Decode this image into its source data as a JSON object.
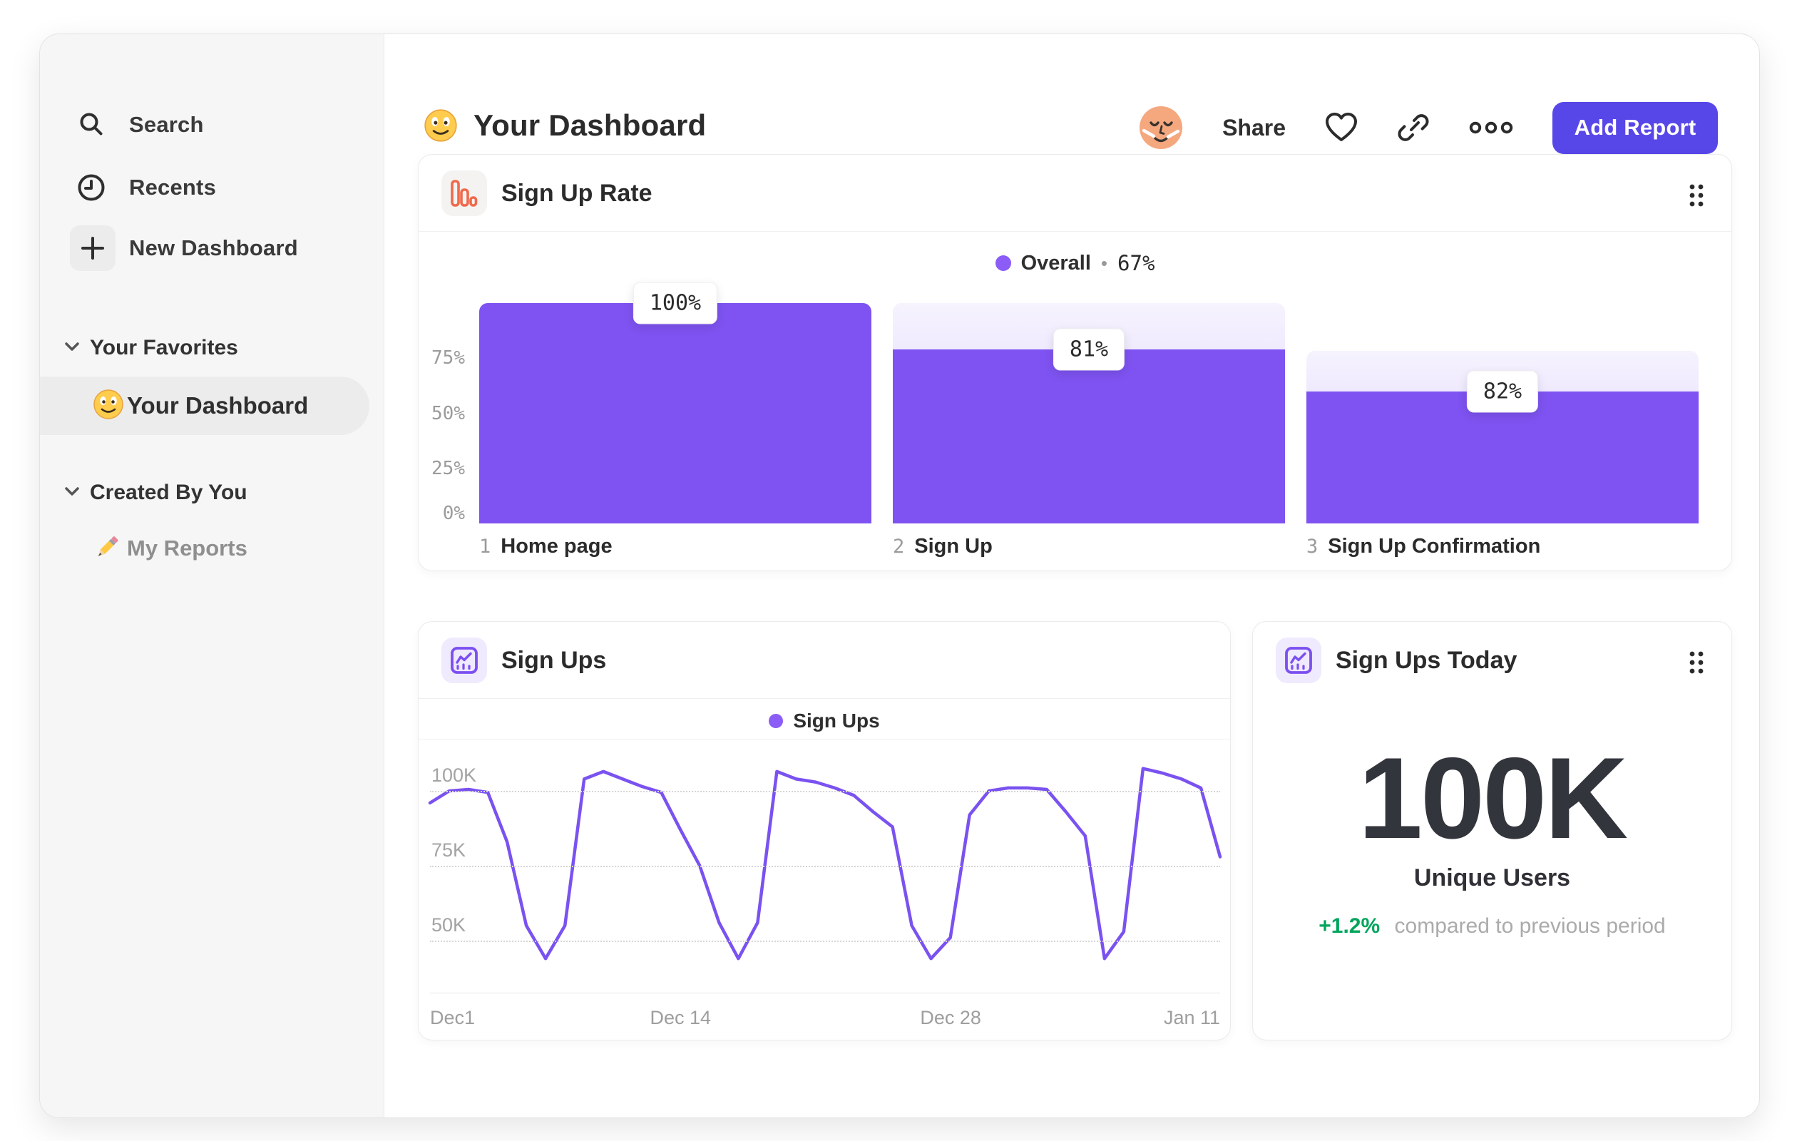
{
  "header": {
    "title": "Your Dashboard",
    "title_emoji": "smiley-emoji",
    "share_label": "Share",
    "add_report_label": "Add Report"
  },
  "sidebar": {
    "items": [
      {
        "icon": "search-icon",
        "label": "Search"
      },
      {
        "icon": "clock-icon",
        "label": "Recents"
      },
      {
        "icon": "plus-icon",
        "label": "New Dashboard"
      }
    ],
    "sections": [
      {
        "label": "Your Favorites",
        "items": [
          {
            "icon": "smiley-emoji",
            "label": "Your Dashboard",
            "selected": true
          }
        ]
      },
      {
        "label": "Created By You",
        "items": [
          {
            "icon": "pencil-emoji",
            "label": "My Reports",
            "selected": false
          }
        ]
      }
    ]
  },
  "cards": {
    "sign_up_rate": {
      "title": "Sign Up Rate",
      "icon": "funnel-bars-icon",
      "legend": {
        "name": "Overall",
        "separator": "•",
        "value": "67%"
      }
    },
    "sign_ups": {
      "title": "Sign Ups",
      "icon": "line-chart-icon",
      "legend": {
        "name": "Sign Ups"
      }
    },
    "sign_ups_today": {
      "title": "Sign Ups Today",
      "icon": "line-chart-icon",
      "value": "100K",
      "subtitle": "Unique Users",
      "delta": "+1.2%",
      "delta_note": "compared to previous period"
    }
  },
  "colors": {
    "accent_purple": "#7E53F1",
    "legend_purple": "#8B5CF6",
    "line_purple": "#7A52F0",
    "button_purple": "#5847E8",
    "funnel_icon_orange": "#F0694B",
    "delta_green": "#00A45C"
  },
  "chart_data": [
    {
      "type": "bar",
      "subtype": "funnel",
      "title": "Sign Up Rate",
      "overall_conversion": "67%",
      "ylabel": "",
      "xlabel": "",
      "ylim": [
        0,
        100
      ],
      "y_ticks": [
        {
          "label": "75%",
          "value": 75
        },
        {
          "label": "50%",
          "value": 50
        },
        {
          "label": "25%",
          "value": 25
        },
        {
          "label": "0%",
          "value": 0
        }
      ],
      "steps": [
        {
          "index": "1",
          "label": "Home page",
          "display_pct": "100%",
          "total_frac": 1.0,
          "solid_frac": 1.0
        },
        {
          "index": "2",
          "label": "Sign Up",
          "display_pct": "81%",
          "total_frac": 1.0,
          "solid_frac": 0.79
        },
        {
          "index": "3",
          "label": "Sign Up Confirmation",
          "display_pct": "82%",
          "total_frac": 0.783,
          "solid_frac": 0.6
        }
      ]
    },
    {
      "type": "line",
      "title": "Sign Ups",
      "legend_position": "top-center",
      "grid": "dotted-horizontal",
      "y_ticks": [
        {
          "label": "100K",
          "value": 100
        },
        {
          "label": "75K",
          "value": 75
        },
        {
          "label": "50K",
          "value": 50
        }
      ],
      "y_map": {
        "top_value": 116,
        "bottom_value": 32.6
      },
      "x_ticks": [
        {
          "label": "Dec1",
          "fraction": 0.0,
          "align": "left"
        },
        {
          "label": "Dec 14",
          "fraction": 0.317,
          "align": "center"
        },
        {
          "label": "Dec 28",
          "fraction": 0.659,
          "align": "center"
        },
        {
          "label": "Jan 11",
          "fraction": 1.0,
          "align": "right"
        }
      ],
      "series": [
        {
          "name": "Sign Ups",
          "unit": "K",
          "values": [
            96,
            100,
            100.5,
            99.5,
            83,
            55,
            44,
            55,
            104,
            106.5,
            104,
            101.5,
            99.5,
            87,
            75,
            56,
            44,
            56,
            106.5,
            104,
            103,
            101,
            98.5,
            93,
            88,
            55,
            44,
            51,
            92,
            100,
            101,
            101,
            100.5,
            93,
            85,
            44,
            53,
            107.5,
            106,
            104,
            101,
            78
          ]
        }
      ]
    }
  ]
}
